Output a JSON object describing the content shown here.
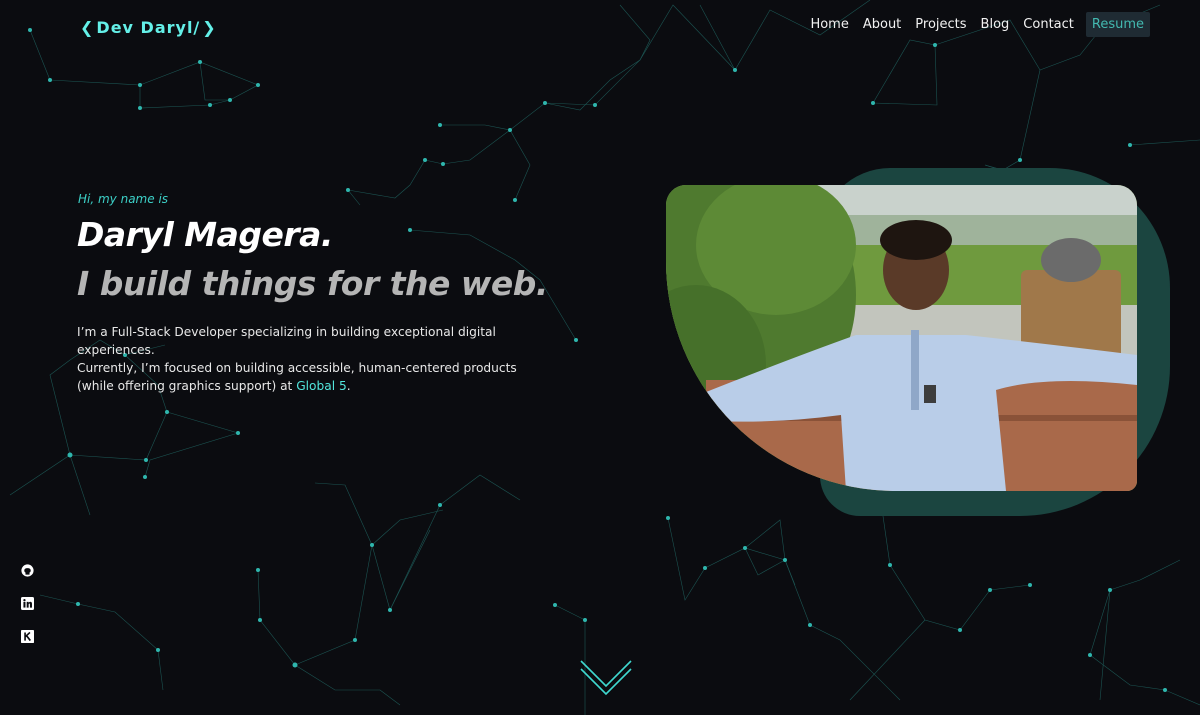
{
  "logo": {
    "text": "Dev Daryl/"
  },
  "nav": {
    "items": [
      {
        "label": "Home"
      },
      {
        "label": "About"
      },
      {
        "label": "Projects"
      },
      {
        "label": "Blog"
      },
      {
        "label": "Contact"
      }
    ],
    "resume_label": "Resume"
  },
  "hero": {
    "greeting": "Hi, my name is",
    "name": "Daryl Magera.",
    "tagline": "I build things for the web.",
    "desc_line1": "I’m a Full-Stack Developer specializing in building exceptional digital experiences.",
    "desc_line2": "Currently, I’m focused on building accessible, human-centered products",
    "desc_line3_prefix": "(while offering graphics support) at ",
    "desc_link": "Global 5",
    "desc_line3_suffix": "."
  },
  "social": [
    {
      "icon": "github-icon"
    },
    {
      "icon": "linkedin-icon"
    },
    {
      "icon": "kaggle-icon"
    }
  ],
  "colors": {
    "accent": "#64f0e8",
    "background": "#0b0c10",
    "photo_frame": "#1b4540"
  }
}
